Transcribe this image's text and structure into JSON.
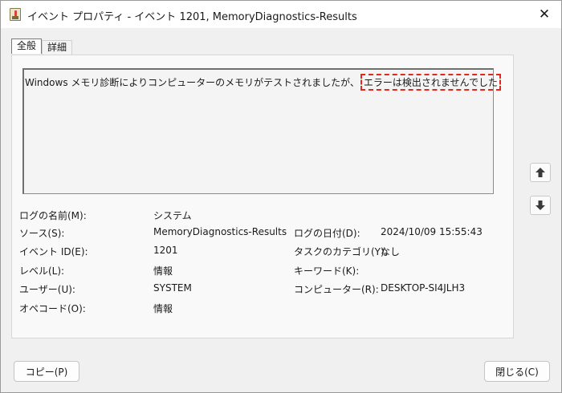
{
  "window": {
    "title": "イベント プロパティ - イベント 1201, MemoryDiagnostics-Results",
    "close_glyph": "✕"
  },
  "tabs": [
    {
      "label": "全般",
      "active": true
    },
    {
      "label": "詳細",
      "active": false
    }
  ],
  "description": {
    "text_prefix": "Windows メモリ診断によりコンピューターのメモリがテストされましたが、",
    "text_highlight": "エラーは検出されませんでした"
  },
  "scroll_buttons": {
    "up_icon": "arrow-up-icon",
    "down_icon": "arrow-down-icon"
  },
  "fields": {
    "log_name": {
      "label": "ログの名前(M):",
      "value": "システム"
    },
    "source": {
      "label": "ソース(S):",
      "value": "MemoryDiagnostics-Results"
    },
    "logged": {
      "label": "ログの日付(D):",
      "value": "2024/10/09 15:55:43"
    },
    "event_id": {
      "label": "イベント ID(E):",
      "value": "1201"
    },
    "task_category": {
      "label": "タスクのカテゴリ(Y):",
      "value": "なし"
    },
    "level": {
      "label": "レベル(L):",
      "value": "情報"
    },
    "keywords": {
      "label": "キーワード(K):",
      "value": ""
    },
    "user": {
      "label": "ユーザー(U):",
      "value": "SYSTEM"
    },
    "computer": {
      "label": "コンピューター(R):",
      "value": "DESKTOP-SI4JLH3"
    },
    "opcode": {
      "label": "オペコード(O):",
      "value": "情報"
    }
  },
  "buttons": {
    "copy": "コピー(P)",
    "close": "閉じる(C)"
  },
  "colors": {
    "highlight_border": "#e0281c"
  }
}
